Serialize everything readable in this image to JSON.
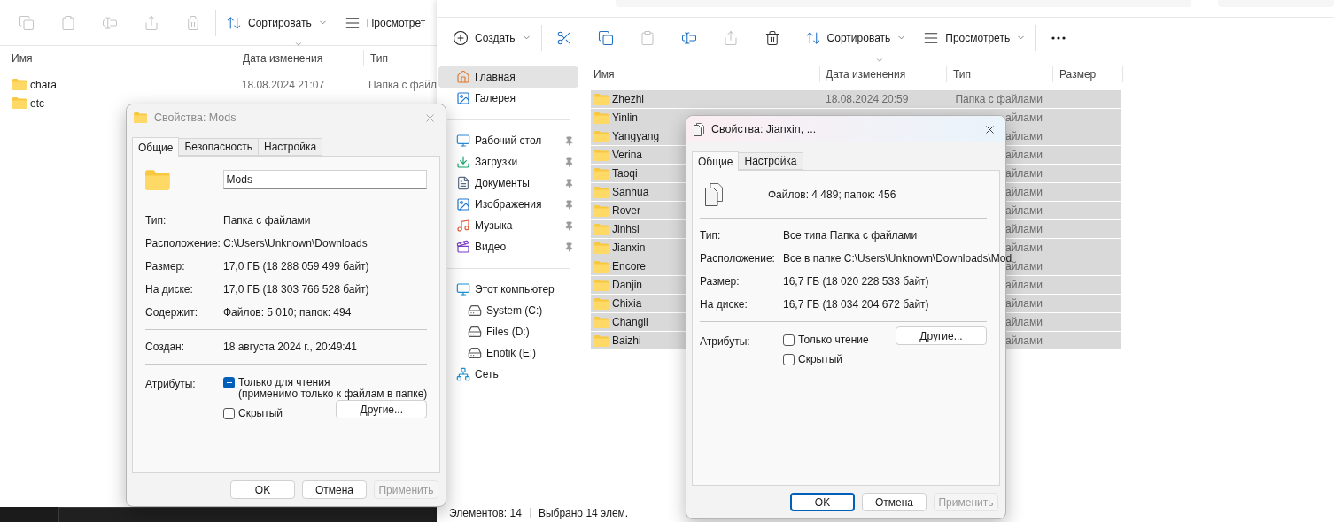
{
  "left_explorer": {
    "toolbar_groups": [
      [
        {
          "kind": "copy",
          "disabled": true
        },
        {
          "kind": "paste",
          "disabled": true
        },
        {
          "kind": "rename",
          "disabled": true
        },
        {
          "kind": "share",
          "disabled": true
        },
        {
          "kind": "delete",
          "disabled": true
        }
      ],
      [
        {
          "kind": "sort",
          "label": "Сортировать",
          "disabled": false,
          "dropdown": true
        },
        {
          "kind": "view",
          "label": "Просмотрет",
          "disabled": false,
          "dropdown": false
        }
      ]
    ],
    "columns": [
      "Имя",
      "Дата изменения",
      "Тип"
    ],
    "rows": [
      {
        "name": "chara",
        "date": "18.08.2024 21:07",
        "type": "Папка с файл"
      },
      {
        "name": "etc"
      }
    ]
  },
  "right_explorer": {
    "toolbar_groups": [
      [
        {
          "kind": "new",
          "label": "Создать",
          "disabled": false,
          "dropdown": true
        }
      ],
      [
        {
          "kind": "cut",
          "disabled": false
        },
        {
          "kind": "copy",
          "disabled": false
        },
        {
          "kind": "paste",
          "disabled": true
        },
        {
          "kind": "rename",
          "disabled": false
        },
        {
          "kind": "share",
          "disabled": true
        },
        {
          "kind": "delete",
          "disabled": false
        }
      ],
      [
        {
          "kind": "sort",
          "label": "Сортировать",
          "disabled": false,
          "dropdown": true
        },
        {
          "kind": "view",
          "label": "Просмотреть",
          "disabled": false,
          "dropdown": true
        }
      ],
      [
        {
          "kind": "more",
          "disabled": false
        }
      ]
    ],
    "sidebar": [
      [
        {
          "kind": "home",
          "label": "Главная",
          "selected": true,
          "pinned": false
        },
        {
          "kind": "gallery",
          "label": "Галерея",
          "selected": false,
          "pinned": false
        }
      ],
      [
        {
          "kind": "desktop",
          "label": "Рабочий стол",
          "selected": false,
          "pinned": true
        },
        {
          "kind": "downloads",
          "label": "Загрузки",
          "selected": false,
          "pinned": true
        },
        {
          "kind": "documents",
          "label": "Документы",
          "selected": false,
          "pinned": true
        },
        {
          "kind": "pictures",
          "label": "Изображения",
          "selected": false,
          "pinned": true
        },
        {
          "kind": "music",
          "label": "Музыка",
          "selected": false,
          "pinned": true
        },
        {
          "kind": "video",
          "label": "Видео",
          "selected": false,
          "pinned": true
        }
      ],
      [
        {
          "kind": "computer",
          "label": "Этот компьютер",
          "selected": false,
          "pinned": false,
          "children": [
            {
              "kind": "drive",
              "label": "System (C:)",
              "selected": false,
              "pinned": false
            },
            {
              "kind": "drive",
              "label": "Files (D:)",
              "selected": false,
              "pinned": false
            },
            {
              "kind": "drive",
              "label": "Enotik (E:)",
              "selected": false,
              "pinned": false
            }
          ]
        },
        {
          "kind": "network",
          "label": "Сеть",
          "selected": false,
          "pinned": false
        }
      ]
    ],
    "columns": [
      "Имя",
      "Дата изменения",
      "Тип",
      "Размер"
    ],
    "rows": [
      {
        "name": "Zhezhi",
        "date": "18.08.2024 20:59",
        "type": "Папка с файлами",
        "selected": true
      },
      {
        "name": "Yinlin",
        "type": "айлами",
        "selected": true
      },
      {
        "name": "Yangyang",
        "type": "айлами",
        "selected": true
      },
      {
        "name": "Verina",
        "type": "айлами",
        "selected": true
      },
      {
        "name": "Taoqi",
        "type": "айлами",
        "selected": true
      },
      {
        "name": "Sanhua",
        "type": "айлами",
        "selected": true
      },
      {
        "name": "Rover",
        "type": "айлами",
        "selected": true
      },
      {
        "name": "Jinhsi",
        "type": "айлами",
        "selected": true
      },
      {
        "name": "Jianxin",
        "type": "айлами",
        "selected": true
      },
      {
        "name": "Encore",
        "type": "айлами",
        "selected": true
      },
      {
        "name": "Danjin",
        "type": "айлами",
        "selected": true
      },
      {
        "name": "Chixia",
        "type": "айлами",
        "selected": true
      },
      {
        "name": "Changli",
        "type": "айлами",
        "selected": true
      },
      {
        "name": "Baizhi",
        "type": "айлами",
        "selected": true
      }
    ],
    "status_bar": [
      "Элементов: 14",
      "Выбрано 14 элем."
    ]
  },
  "properties_mods": {
    "kind": "folder",
    "title": "Свойства: Mods",
    "active": false,
    "tabs": [
      {
        "label": "Общие",
        "selected": true
      },
      {
        "label": "Безопасность",
        "selected": false
      },
      {
        "label": "Настройка",
        "selected": false
      }
    ],
    "name": "Mods",
    "groups": [
      [
        {
          "label": "Тип:",
          "value": "Папка с файлами"
        },
        {
          "label": "Расположение:",
          "value": "C:\\Users\\Unknown\\Downloads"
        },
        {
          "label": "Размер:",
          "value": "17,0 ГБ (18 288 059 499 байт)"
        },
        {
          "label": "На диске:",
          "value": "17,0 ГБ (18 303 766 528 байт)"
        },
        {
          "label": "Содержит:",
          "value": "Файлов: 5 010; папок: 494"
        }
      ],
      [
        {
          "label": "Создан:",
          "value": "18 августа 2024 г., 20:49:41"
        }
      ]
    ],
    "attributes_label": "Атрибуты:",
    "attributes": [
      {
        "label": "Только для чтения",
        "note": "(применимо только к файлам в папке)",
        "indeterminate": true
      },
      {
        "label": "Скрытый",
        "checked": false,
        "indeterminate": false,
        "button": "Другие..."
      }
    ],
    "buttons": [
      {
        "label": "OK",
        "default": false,
        "disabled": false
      },
      {
        "label": "Отмена",
        "default": false,
        "disabled": false
      },
      {
        "label": "Применить",
        "default": false,
        "disabled": true
      }
    ]
  },
  "properties_jianxin": {
    "kind": "files",
    "title": "Свойства: Jianxin, ...",
    "active": true,
    "tabs": [
      {
        "label": "Общие",
        "selected": true
      },
      {
        "label": "Настройка",
        "selected": false
      }
    ],
    "summary": "Файлов: 4 489; папок: 456",
    "groups": [
      [
        {
          "label": "Тип:",
          "value": "Все типа Папка с файлами"
        },
        {
          "label": "Расположение:",
          "value": "Все в папке C:\\Users\\Unknown\\Downloads\\Mod"
        },
        {
          "label": "Размер:",
          "value": "16,7 ГБ (18 020 228 533 байт)"
        },
        {
          "label": "На диске:",
          "value": "16,7 ГБ (18 034 204 672 байт)"
        }
      ]
    ],
    "attributes_label": "Атрибуты:",
    "attributes": [
      {
        "label": "Только чтение",
        "checked": false,
        "indeterminate": false,
        "button": "Другие..."
      },
      {
        "label": "Скрытый",
        "checked": false,
        "indeterminate": false
      }
    ],
    "buttons": [
      {
        "label": "OK",
        "default": true,
        "disabled": false
      },
      {
        "label": "Отмена",
        "default": false,
        "disabled": false
      },
      {
        "label": "Применить",
        "default": false,
        "disabled": true
      }
    ]
  }
}
